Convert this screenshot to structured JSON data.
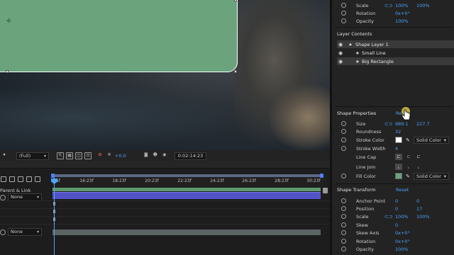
{
  "viewer": {
    "zoom": "(Full)",
    "exposure": "+0.0",
    "timecode": "0:02:14:23"
  },
  "timeline": {
    "parent_link_label": "Parent & Link",
    "parent_rows": [
      {
        "value": "None"
      },
      {
        "value": "None"
      }
    ],
    "ruler_ticks": [
      "15f",
      "16:23f",
      "18:23f",
      "20:23f",
      "22:23f",
      "24:23f",
      "26:23f",
      "28:23f",
      "30:23f"
    ]
  },
  "properties": {
    "transform_top": [
      {
        "label": "Scale",
        "values": [
          "100%",
          "100%"
        ],
        "link": true
      },
      {
        "label": "Rotation",
        "values": [
          "0x+0°"
        ]
      },
      {
        "label": "Opacity",
        "values": [
          "100%"
        ]
      }
    ],
    "layer_contents": {
      "title": "Layer Contents",
      "items": [
        {
          "name": "Shape Layer 1",
          "level": 0,
          "highlighted": true
        },
        {
          "name": "Small Line",
          "level": 1,
          "highlighted": false
        },
        {
          "name": "Big Rectangle",
          "level": 1,
          "highlighted": true
        }
      ]
    },
    "shape_properties": {
      "title": "Shape Properties",
      "reset": "Reset",
      "size_label": "Size",
      "size_values": [
        "989.1",
        "227.7"
      ],
      "roundness_label": "Roundness",
      "roundness_value": "32",
      "stroke_color_label": "Stroke Color",
      "stroke_color": "#ffffff",
      "stroke_mode": "Solid Color",
      "stroke_width_label": "Stroke Width",
      "stroke_width_value": "4",
      "line_cap_label": "Line Cap",
      "line_join_label": "Line Join",
      "fill_color_label": "Fill Color",
      "fill_color": "#6aa37c",
      "fill_mode": "Solid Color"
    },
    "shape_transform": {
      "title": "Shape Transform",
      "reset": "Reset",
      "rows": [
        {
          "label": "Anchor Point",
          "values": [
            "0",
            "0"
          ]
        },
        {
          "label": "Position",
          "values": [
            "0",
            "17"
          ]
        },
        {
          "label": "Scale",
          "values": [
            "100%",
            "100%"
          ],
          "link": true
        },
        {
          "label": "Skew",
          "values": [
            "0"
          ]
        },
        {
          "label": "Skew Axis",
          "values": [
            "0x+0°"
          ]
        },
        {
          "label": "Rotation",
          "values": [
            "0x+0°"
          ]
        },
        {
          "label": "Opacity",
          "values": [
            "100%"
          ]
        }
      ]
    }
  },
  "colors": {
    "accent": "#4aa3ff",
    "rect_fill": "#6aa37c",
    "layer_bar": "#5353c8"
  }
}
